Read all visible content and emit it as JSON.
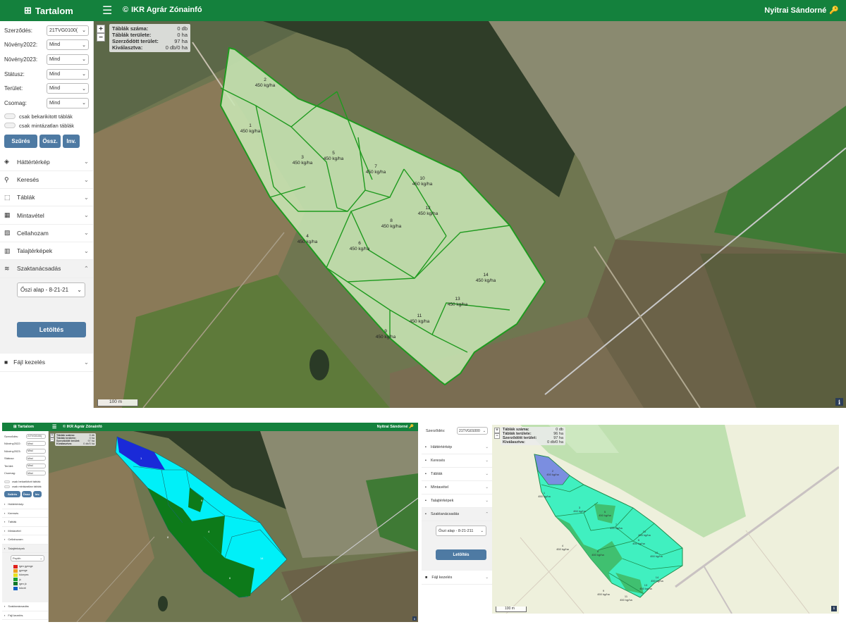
{
  "main": {
    "brand": "Tartalom",
    "app_title": "IKR Agrár Zónainfó",
    "user": "Nyitrai Sándorné",
    "filters": [
      {
        "label": "Szerződés:",
        "value": "21TVG0100("
      },
      {
        "label": "Növény2022:",
        "value": "Mind"
      },
      {
        "label": "Növény2023:",
        "value": "Mind"
      },
      {
        "label": "Státusz:",
        "value": "Mind"
      },
      {
        "label": "Terület:",
        "value": "Mind"
      },
      {
        "label": "Csomag:",
        "value": "Mind"
      }
    ],
    "toggles": [
      "csak bekarikitott táblák",
      "csak mintázatlan táblák"
    ],
    "buttons": [
      "Szűrés",
      "Össz.",
      "Inv."
    ],
    "accordion": [
      {
        "label": "Háttértérkép",
        "icon": "layers-icon",
        "open": false
      },
      {
        "label": "Keresés",
        "icon": "search-icon",
        "open": false
      },
      {
        "label": "Táblák",
        "icon": "dashed-square-icon",
        "open": false
      },
      {
        "label": "Mintavétel",
        "icon": "grid-icon",
        "open": false
      },
      {
        "label": "Cellahozam",
        "icon": "image-icon",
        "open": false
      },
      {
        "label": "Talajtérképek",
        "icon": "map-icon",
        "open": false
      },
      {
        "label": "Szaktanácsadás",
        "icon": "tornado-icon",
        "open": true
      }
    ],
    "advice_select": "Őszi alap - 8-21-21",
    "download": "Letöltés",
    "file_menu": "Fájl kezelés",
    "info": [
      {
        "k": "Táblák száma:",
        "v": "0 db"
      },
      {
        "k": "Táblák területe:",
        "v": "0 ha"
      },
      {
        "k": "Szerződött terület:",
        "v": "97 ha"
      },
      {
        "k": "Kiválasztva:",
        "v": "0 db/0 ha"
      }
    ],
    "zoom_in": "+",
    "zoom_out": "−",
    "scale": "100 m",
    "info_btn": "i",
    "fields": [
      {
        "num": "2",
        "rate": "450 kg/ha"
      },
      {
        "num": "1",
        "rate": "450 kg/ha"
      },
      {
        "num": "3",
        "rate": "450 kg/ha"
      },
      {
        "num": "5",
        "rate": "450 kg/ha"
      },
      {
        "num": "7",
        "rate": "450 kg/ha"
      },
      {
        "num": "10",
        "rate": "450 kg/ha"
      },
      {
        "num": "12",
        "rate": "450 kg/ha"
      },
      {
        "num": "8",
        "rate": "450 kg/ha"
      },
      {
        "num": "4",
        "rate": "450 kg/ha"
      },
      {
        "num": "6",
        "rate": "450 kg/ha"
      },
      {
        "num": "14",
        "rate": "450 kg/ha"
      },
      {
        "num": "13",
        "rate": "450 kg/ha"
      },
      {
        "num": "11",
        "rate": "450 kg/ha"
      },
      {
        "num": "9",
        "rate": "450 kg/ha"
      }
    ]
  },
  "thumb_left": {
    "brand": "Tartalom",
    "app_title": "IKR Agrár Zónainfó",
    "user": "Nyitrai Sándorné",
    "filters": [
      {
        "label": "Szerződés:",
        "value": "21TVG0100("
      },
      {
        "label": "Növény2022:",
        "value": "Mind"
      },
      {
        "label": "Növény2023:",
        "value": "Mind"
      },
      {
        "label": "Státusz:",
        "value": "Mind"
      },
      {
        "label": "Terület:",
        "value": "Mind"
      },
      {
        "label": "Csomag:",
        "value": "Mind"
      }
    ],
    "toggles": [
      "csak bekarikitott táblák",
      "csak mintázatlan táblák"
    ],
    "buttons": [
      "Szűrés",
      "Össz.",
      "Inv."
    ],
    "accordion_top": [
      "Háttértérkép",
      "Keresés",
      "Táblák",
      "Mintavétel",
      "Cellahozam",
      "Talajtérképek"
    ],
    "soil_select": "Pzpiťn",
    "legend": [
      {
        "color": "#e0201b",
        "label": "igen gyenge"
      },
      {
        "color": "#f0a020",
        "label": "gyenge"
      },
      {
        "color": "#e8e020",
        "label": "közepes"
      },
      {
        "color": "#18a030",
        "label": "jó"
      },
      {
        "color": "#107828",
        "label": "igen jó"
      },
      {
        "color": "#1060c0",
        "label": "túlzott"
      }
    ],
    "accordion_bottom": [
      "Szaktanácsadás",
      "Fájl kezelés"
    ],
    "info": [
      {
        "k": "Táblák száma:",
        "v": "0 db"
      },
      {
        "k": "Táblák területe:",
        "v": "0 ha"
      },
      {
        "k": "Szerződött terület:",
        "v": "97 ha"
      },
      {
        "k": "Kiválasztva:",
        "v": "0 db/0 ha"
      }
    ],
    "field_nums": [
      "1",
      "9",
      "8",
      "4",
      "6",
      "14"
    ]
  },
  "thumb_right": {
    "filter_label": "Szerződés:",
    "filter_value": "21TVG01000",
    "accordion": [
      "Háttértérkép",
      "Keresés",
      "Táblák",
      "Mintavétel",
      "Talajtérképek",
      "Szaktanácsadás"
    ],
    "advice_select": "Őszi alap - 8-21-211",
    "download": "Letöltés",
    "file_menu": "Fájl kezelés",
    "info": [
      {
        "k": "Táblák száma:",
        "v": "0 db"
      },
      {
        "k": "Táblák területe:",
        "v": "96 ha"
      },
      {
        "k": "Szerződött terület:",
        "v": "97 ha"
      },
      {
        "k": "Kiválasztva:",
        "v": "0 db/0 ha"
      }
    ],
    "fields": [
      {
        "num": "2",
        "rate": "450 kg/ha"
      },
      {
        "num": "1",
        "rate": "450 kg/ha"
      },
      {
        "num": "3",
        "rate": "450 kg/ha"
      },
      {
        "num": "5",
        "rate": "450 kg/ha"
      },
      {
        "num": "7",
        "rate": "450 kg/ha"
      },
      {
        "num": "10",
        "rate": "450 kg/ha"
      },
      {
        "num": "4",
        "rate": "450 kg/ha"
      },
      {
        "num": "8",
        "rate": "450 kg/ha"
      },
      {
        "num": "6",
        "rate": "450 kg/ha"
      },
      {
        "num": "12",
        "rate": "450 kg/ha"
      },
      {
        "num": "14",
        "rate": "450 kg/ha"
      },
      {
        "num": "13",
        "rate": "450 kg/ha"
      },
      {
        "num": "11",
        "rate": "450 kg/ha"
      },
      {
        "num": "9",
        "rate": "450 kg/ha"
      }
    ],
    "scale": "100 m"
  },
  "colors": {
    "header_green": "#14813d",
    "button_blue": "#4e7aa3",
    "field_fill_main": "#c8e6b4",
    "field_border": "#1f9a1f",
    "cyan_zone": "#00f0f8",
    "dark_green_zone": "#0d7a1a",
    "blue_zone": "#1a2ad8",
    "aqua_zone": "#40f0c0"
  }
}
